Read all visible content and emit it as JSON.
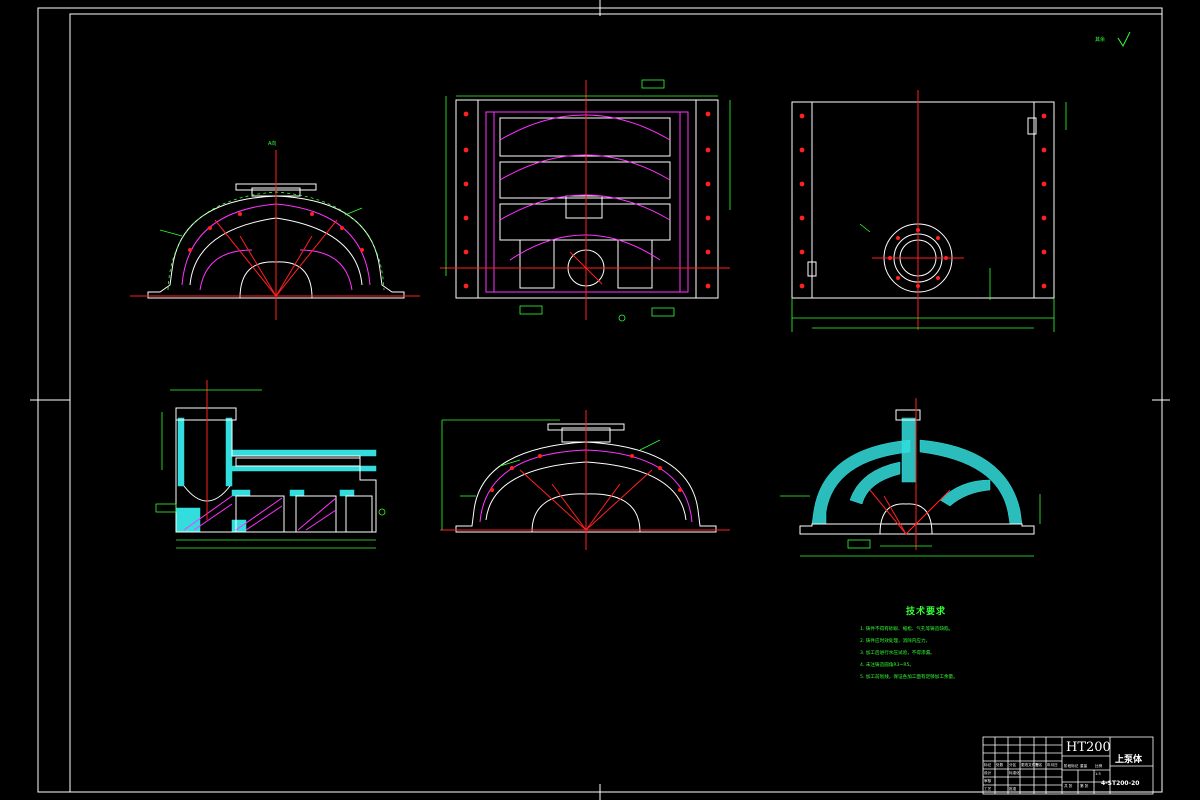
{
  "drawing": {
    "title_block": {
      "material": "HT200",
      "part_name": "上泵体",
      "drawing_number": "4-ST200-20",
      "cells": [
        "标记",
        "处数",
        "分区",
        "更改文件号",
        "签名",
        "年月日",
        "设计",
        "标准化",
        "阶段标记",
        "重量",
        "比例",
        "审核",
        "工艺",
        "批准",
        "共 张",
        "第 张",
        "1:5"
      ]
    },
    "technical_requirements": {
      "title": "技术要求",
      "items": [
        "1. 铸件不得有砂眼、缩松、气孔等铸造缺陷。",
        "2. 铸件应时效处理，消除内应力。",
        "3. 加工后进行水压试验，不得渗漏。",
        "4. 未注铸造圆角R3~R5。",
        "5. 加工前划线，保证各加工面有足够加工余量。"
      ]
    },
    "roughness_note": "其余",
    "view_label": "A向",
    "colors": {
      "background": "#000000",
      "outline": "#ffffff",
      "dimension": "#33ff33",
      "centerline": "#ff2020",
      "hidden": "#ff33ff",
      "hatch": "#33dddd"
    }
  }
}
